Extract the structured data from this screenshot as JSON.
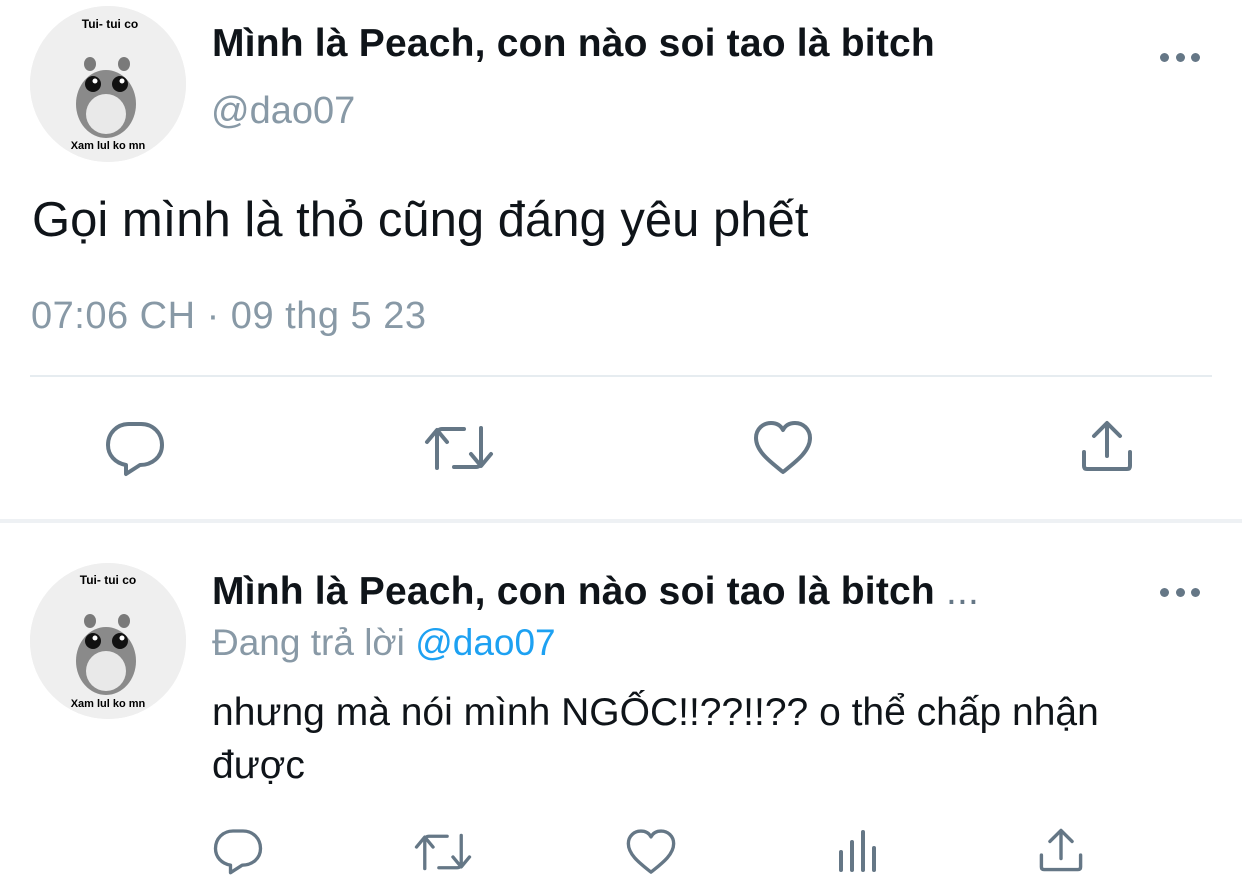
{
  "tweet": {
    "avatar": {
      "top_text": "Tui- tui co",
      "bottom_text": "Xam lul ko mn"
    },
    "author_name": "Mình là Peach, con nào soi tao là bitch",
    "handle": "@dao07",
    "text": "Gọi mình là thỏ cũng đáng yêu phết",
    "timestamp": "07:06 CH · 09 thg 5 23",
    "actions": [
      "reply-icon",
      "retweet-icon",
      "like-icon",
      "share-icon"
    ]
  },
  "reply": {
    "avatar": {
      "top_text": "Tui- tui co",
      "bottom_text": "Xam lul ko mn"
    },
    "author_name": "Mình là Peach, con nào soi tao là bitch",
    "name_truncation": "...",
    "replying_label": "Đang trả lời",
    "replying_handle": "@dao07",
    "text_line1": "nhưng mà nói mình NGỐC!!??!!?? o thể chấp nhận",
    "text_line2": "được",
    "actions": [
      "reply-icon",
      "retweet-icon",
      "like-icon",
      "analytics-icon",
      "share-icon"
    ]
  },
  "colors": {
    "text": "#0f1419",
    "secondary": "#8899a6",
    "icon": "#657786",
    "link": "#1da1f2"
  }
}
